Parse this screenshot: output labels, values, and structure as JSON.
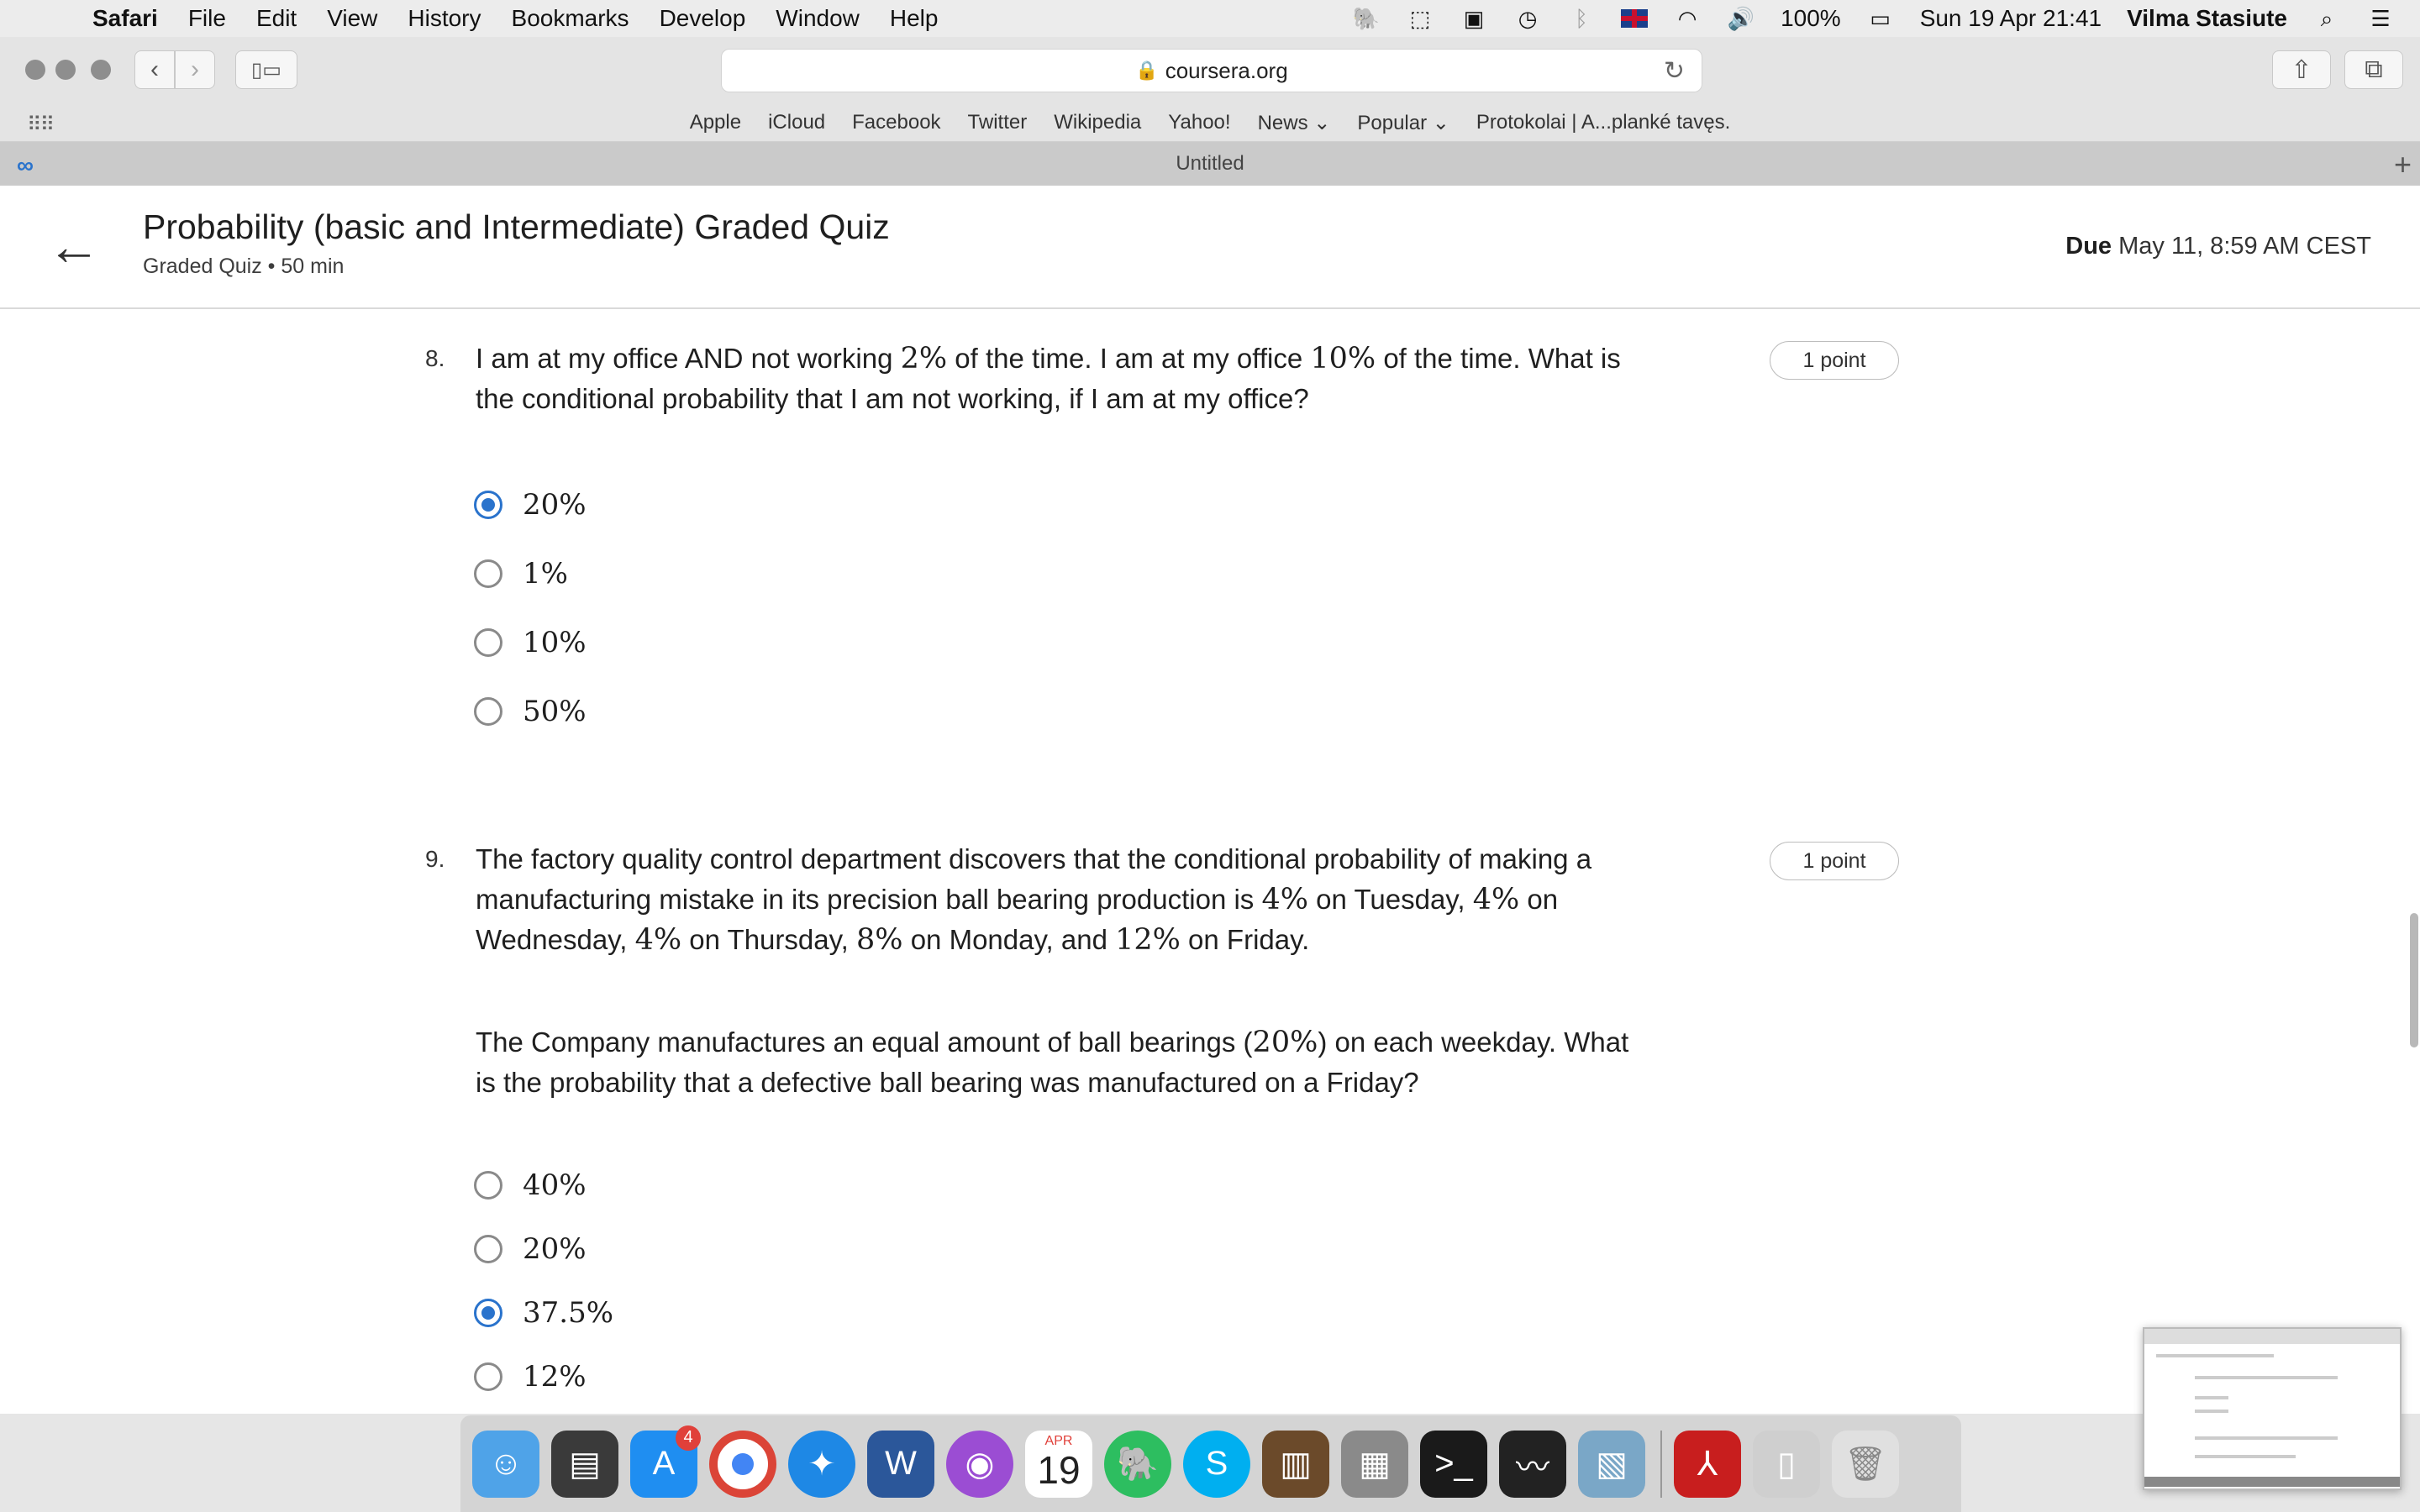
{
  "menubar": {
    "app_name": "Safari",
    "items": [
      "File",
      "Edit",
      "View",
      "History",
      "Bookmarks",
      "Develop",
      "Window",
      "Help"
    ],
    "battery": "100%",
    "datetime": "Sun 19 Apr  21:41",
    "user": "Vilma Stasiute"
  },
  "toolbar": {
    "url": "coursera.org"
  },
  "favorites": [
    "Apple",
    "iCloud",
    "Facebook",
    "Twitter",
    "Wikipedia",
    "Yahoo!",
    "News ⌄",
    "Popular ⌄",
    "Protokolai | A...planké tavęs."
  ],
  "tab": {
    "title": "Untitled"
  },
  "quiz": {
    "title": "Probability (basic and Intermediate) Graded Quiz",
    "subtitle": "Graded Quiz • 50 min",
    "due_label": "Due",
    "due_value": "May 11, 8:59 AM CEST"
  },
  "questions": [
    {
      "number": "8.",
      "points": "1 point",
      "text_parts": [
        "I am at my office AND not working ",
        "2%",
        " of the time. I am at my office ",
        "10%",
        " of the time. What is the conditional probability that I am not working, if I am at my office?"
      ],
      "options": [
        "20%",
        "1%",
        "10%",
        "50%"
      ],
      "selected": 0
    },
    {
      "number": "9.",
      "points": "1 point",
      "text_parts": [
        "The factory quality control department discovers that the conditional probability of making a manufacturing mistake in its precision ball bearing production is ",
        "4%",
        " on Tuesday, ",
        "4%",
        " on Wednesday, ",
        "4%",
        " on Thursday, ",
        "8%",
        " on Monday, and ",
        "12%",
        " on Friday."
      ],
      "text2_parts": [
        "The Company manufactures an equal amount of ball bearings (",
        "20%",
        ") on each weekday. What is the probability that a defective ball bearing was manufactured on a Friday?"
      ],
      "options": [
        "40%",
        "20%",
        "37.5%",
        "12%"
      ],
      "selected": 2
    }
  ],
  "dock": {
    "calendar_month": "APR",
    "calendar_day": "19",
    "appstore_badge": "4"
  }
}
